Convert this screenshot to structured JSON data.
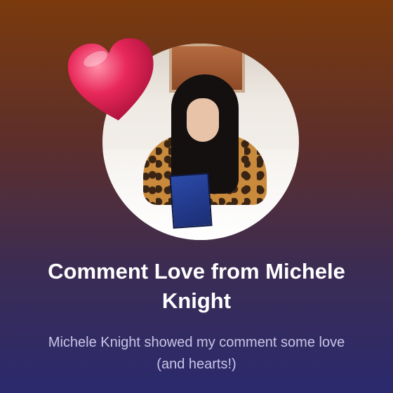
{
  "card": {
    "title": "Comment Love from Michele Knight",
    "subtitle": "Michele Knight showed my comment some love (and hearts!)"
  },
  "icons": {
    "heart": "heart-icon"
  },
  "colors": {
    "background_top": "#7a3a0c",
    "background_bottom": "#2b2a6e",
    "heart": "#e8285a",
    "title_text": "#ffffff",
    "subtitle_text": "#c9c4e6"
  }
}
